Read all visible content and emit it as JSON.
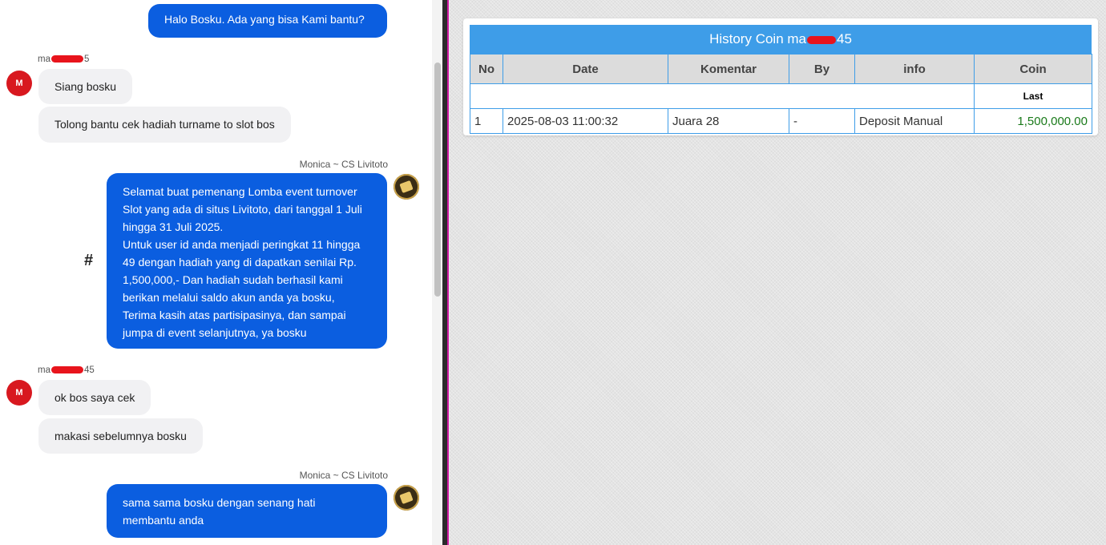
{
  "chat": {
    "messages_top": {
      "greeting": "Halo Bosku. Ada yang bisa Kami bantu?"
    },
    "user_block_1": {
      "sender_prefix": "ma",
      "sender_suffix": "5",
      "avatar_letter": "M",
      "msg1": "Siang bosku",
      "msg2": "Tolong bantu cek hadiah turname to slot bos"
    },
    "agent_block_1": {
      "sender": "Monica ~ CS Livitoto",
      "text": "Selamat buat pemenang Lomba event turnover Slot yang ada di situs Livitoto, dari tanggal 1 Juli hingga 31 Juli 2025.\nUntuk user id anda menjadi peringkat 11 hingga 49 dengan hadiah yang di dapatkan senilai Rp. 1,500,000,- Dan hadiah sudah berhasil kami berikan melalui saldo akun anda ya bosku, Terima kasih atas partisipasinya, dan sampai jumpa di event selanjutnya, ya bosku",
      "hash": "#"
    },
    "user_block_2": {
      "sender_prefix": "ma",
      "sender_suffix": "45",
      "avatar_letter": "M",
      "msg1": "ok bos saya cek",
      "msg2": "makasi sebelumnya bosku"
    },
    "agent_block_2": {
      "sender": "Monica ~ CS Livitoto",
      "text": "sama sama bosku dengan senang hati membantu anda"
    }
  },
  "history": {
    "title_prefix": "History Coin ma",
    "title_suffix": "45",
    "columns": [
      "No",
      "Date",
      "Komentar",
      "By",
      "info",
      "Coin"
    ],
    "subheader_last": "Last",
    "rows": [
      {
        "no": "1",
        "date": "2025-08-03 11:00:32",
        "komentar": "Juara 28",
        "by": "-",
        "info": "Deposit Manual",
        "coin": "1,500,000.00"
      }
    ]
  },
  "colors": {
    "agent_bubble": "#0b5ee0",
    "user_bubble": "#f1f1f3",
    "table_header": "#3e9de8",
    "coin_text": "#1a7a1a",
    "avatar_user": "#d8181f"
  },
  "icons": {
    "user_avatar": "user-avatar-icon",
    "agent_avatar": "agent-avatar-icon",
    "redaction": "redaction-mark"
  }
}
